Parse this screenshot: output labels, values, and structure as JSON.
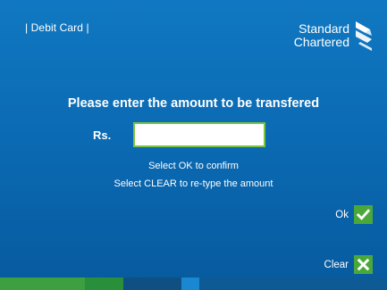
{
  "header": {
    "card_label": "| Debit Card |",
    "logo": {
      "line1": "Standard",
      "line2": "Chartered",
      "icon": "standard-chartered-logo-icon"
    }
  },
  "form": {
    "prompt": "Please enter the amount to be transfered",
    "currency_label": "Rs.",
    "amount_value": "",
    "amount_placeholder": "",
    "hint_confirm": "Select OK to confirm",
    "hint_clear": "Select CLEAR to re-type the amount"
  },
  "actions": {
    "ok": {
      "label": "Ok",
      "icon": "checkmark-icon"
    },
    "clear": {
      "label": "Clear",
      "icon": "x-icon"
    }
  },
  "colors": {
    "background": "#0a68b0",
    "accent_green": "#4aa83a",
    "input_border": "#7cc243"
  }
}
